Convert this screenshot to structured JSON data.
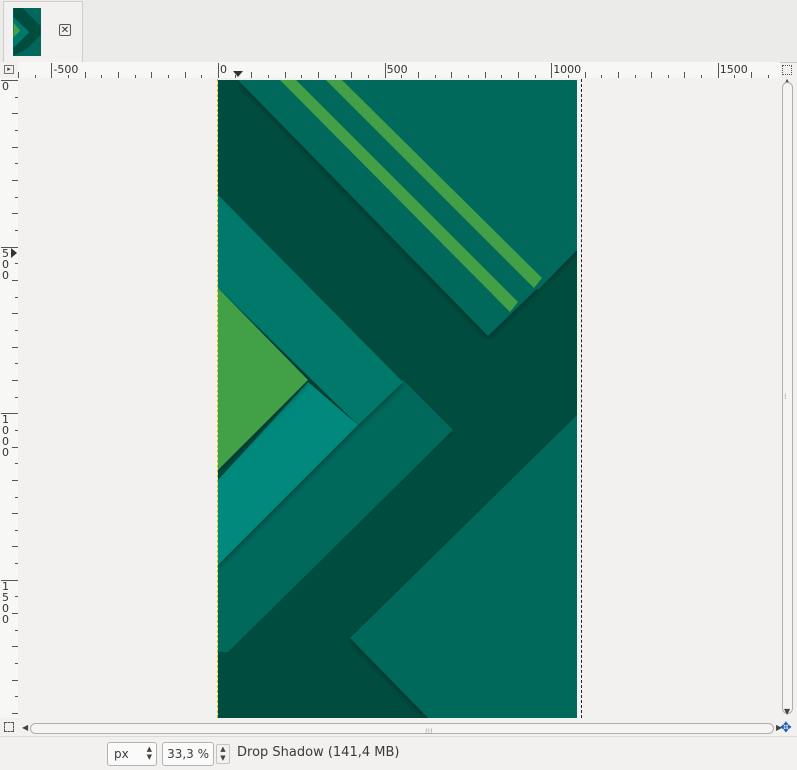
{
  "colors": {
    "darkest": "#004d40",
    "teal_dark": "#00695c",
    "teal_mid": "#00796b",
    "teal_light": "#00897b",
    "green": "#43a047",
    "background": "#f2f1f0"
  },
  "tabs": [
    {
      "image": "wallpaper-thumbnail",
      "close_icon": "close-icon"
    }
  ],
  "rulers": {
    "horizontal_labels": [
      "-500",
      "0",
      "500",
      "1000",
      "1500"
    ],
    "vertical_labels": [
      "0",
      "500",
      "1000",
      "1500"
    ]
  },
  "statusbar": {
    "unit": "px",
    "zoom": "33,3 %",
    "message": "Drop Shadow (141,4 MB)"
  },
  "icons": {
    "tab_close": "close-icon",
    "ruler_toggle": "triangle-right-icon",
    "zoom_lock": "zoom-lock-icon",
    "quick_mask": "quick-mask-icon",
    "navigate": "navigate-icon"
  }
}
